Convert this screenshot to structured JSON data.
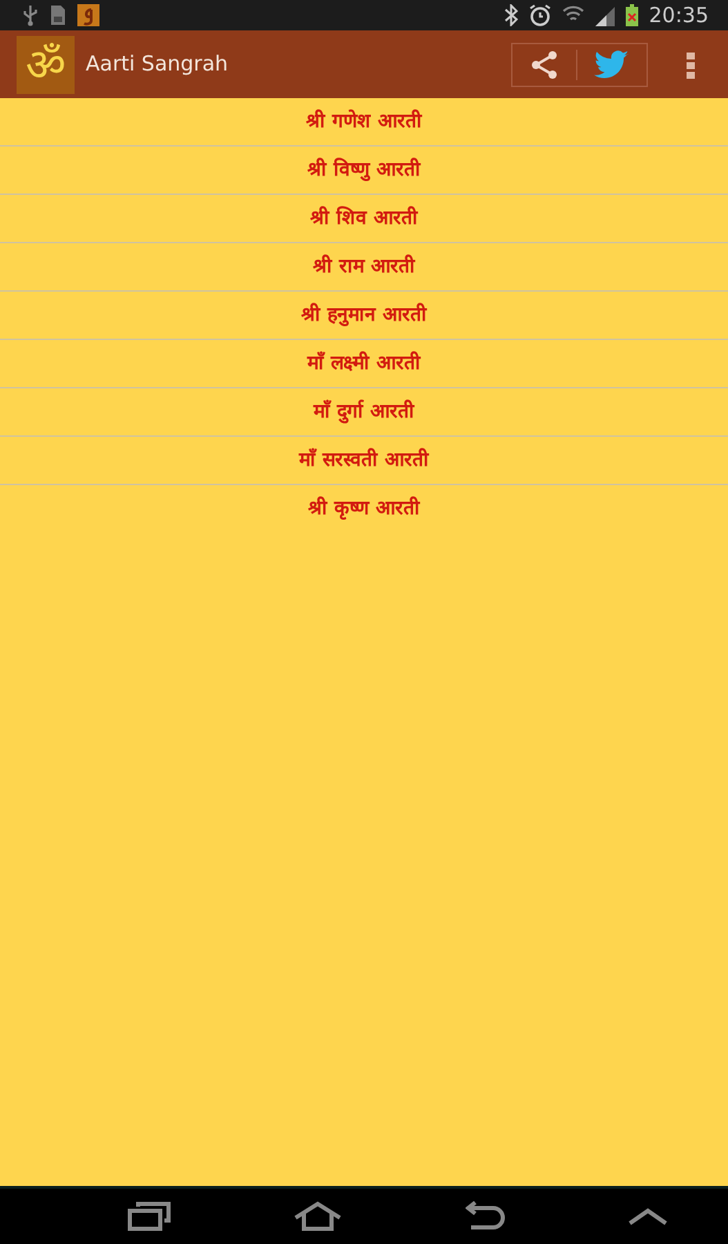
{
  "status_bar": {
    "time": "20:35"
  },
  "app_bar": {
    "logo_glyph": "ॐ",
    "title": "Aarti Sangrah"
  },
  "aartis": [
    {
      "label": "श्री गणेश आरती"
    },
    {
      "label": "श्री विष्णु आरती"
    },
    {
      "label": "श्री शिव आरती"
    },
    {
      "label": "श्री राम आरती"
    },
    {
      "label": "श्री हनुमान आरती"
    },
    {
      "label": "माँ लक्ष्मी आरती"
    },
    {
      "label": "माँ दुर्गा आरती"
    },
    {
      "label": "माँ सरस्वती आरती"
    },
    {
      "label": "श्री कृष्ण आरती"
    }
  ]
}
